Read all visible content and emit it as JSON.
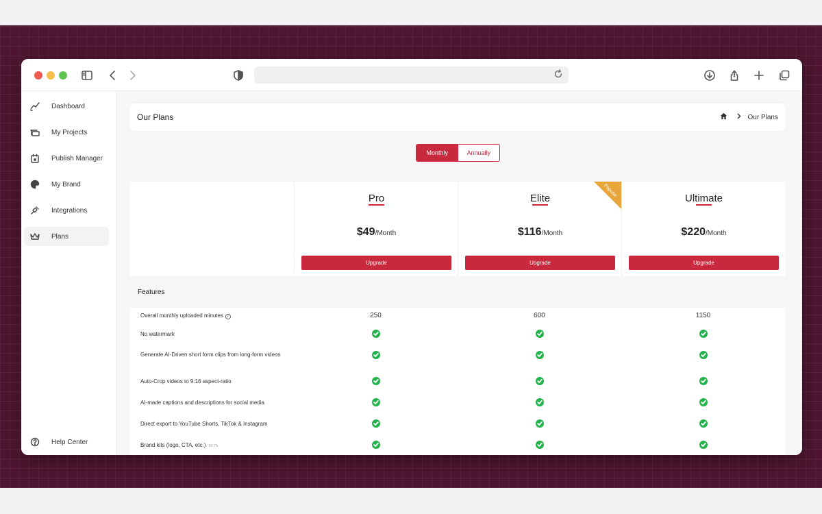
{
  "colors": {
    "accent": "#c8293d",
    "check": "#22b34a",
    "ribbon": "#e8a53c",
    "backdrop": "#4e1630"
  },
  "sidebar": {
    "items": [
      {
        "label": "Dashboard",
        "icon": "chart-line-icon",
        "active": false
      },
      {
        "label": "My Projects",
        "icon": "projects-icon",
        "active": false
      },
      {
        "label": "Publish Manager",
        "icon": "calendar-icon",
        "active": false
      },
      {
        "label": "My Brand",
        "icon": "palette-icon",
        "active": false
      },
      {
        "label": "Integrations",
        "icon": "plug-icon",
        "active": false
      },
      {
        "label": "Plans",
        "icon": "crown-icon",
        "active": true
      }
    ],
    "help": {
      "label": "Help Center",
      "icon": "help-circle-icon"
    }
  },
  "header": {
    "title": "Our Plans",
    "breadcrumb": {
      "home_icon": "home-icon",
      "current": "Our Plans"
    }
  },
  "billing_toggle": {
    "monthly": "Monthly",
    "annually": "Annually",
    "selected": "Monthly"
  },
  "plans": [
    {
      "name": "Pro",
      "price": "$49",
      "period": "/Month",
      "button": "Upgrade",
      "badge": ""
    },
    {
      "name": "Elite",
      "price": "$116",
      "period": "/Month",
      "button": "Upgrade",
      "badge": "Popular"
    },
    {
      "name": "Ultimate",
      "price": "$220",
      "period": "/Month",
      "button": "Upgrade",
      "badge": ""
    }
  ],
  "features": {
    "title": "Features",
    "rows": [
      {
        "label": "Overall monthly uploaded minutes",
        "info": true,
        "beta": "",
        "values": [
          "250",
          "600",
          "1150"
        ]
      },
      {
        "label": "No watermark",
        "info": false,
        "beta": "",
        "values": [
          "check",
          "check",
          "check"
        ]
      },
      {
        "label": "Generate AI-Driven short form clips from long-form videos",
        "info": false,
        "beta": "",
        "values": [
          "check",
          "check",
          "check"
        ]
      },
      {
        "label": "Auto-Crop videos to 9:16 aspect-ratio",
        "info": false,
        "beta": "",
        "values": [
          "check",
          "check",
          "check"
        ]
      },
      {
        "label": "AI-made captions and descriptions for social media",
        "info": false,
        "beta": "",
        "values": [
          "check",
          "check",
          "check"
        ]
      },
      {
        "label": "Direct export to YouTube Shorts, TikTok & Instagram",
        "info": false,
        "beta": "",
        "values": [
          "check",
          "check",
          "check"
        ]
      },
      {
        "label": "Brand kits (logo, CTA, etc.)",
        "info": false,
        "beta": "BETA",
        "values": [
          "check",
          "check",
          "check"
        ]
      }
    ]
  },
  "chat": {
    "icon": "chat-icon"
  }
}
